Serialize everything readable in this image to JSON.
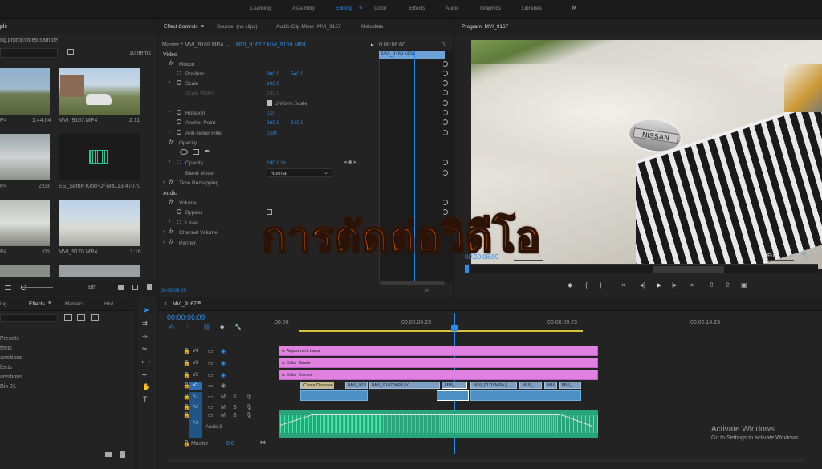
{
  "workspace": {
    "tabs": [
      "Learning",
      "Assembly",
      "Editing",
      "Color",
      "Effects",
      "Audio",
      "Graphics",
      "Libraries"
    ],
    "active": "Editing",
    "more": "»"
  },
  "project": {
    "title_partial": "ple",
    "path_partial": "ng.prproj\\Video sample",
    "items_count": "10 Items",
    "clips": [
      {
        "name": "P4",
        "duration": "1:44:04"
      },
      {
        "name": "MVI_9167.MP4",
        "duration": "2:11"
      },
      {
        "name": "P4",
        "duration": "2:03"
      },
      {
        "name": "ES_Some-Kind-Of-Ma...",
        "duration": "13:47070"
      },
      {
        "name": "P4",
        "duration": ":05"
      },
      {
        "name": "MVI_9170.MP4",
        "duration": "1:16"
      }
    ],
    "bin_label": "Bin"
  },
  "effects_panel": {
    "tabs": [
      "ing",
      "Effects",
      "Markers",
      "Hist"
    ],
    "items": [
      "Presets",
      "fects",
      "ansitions",
      "fects",
      "ansitions",
      "Bin 01"
    ]
  },
  "effect_controls": {
    "tabs": [
      "Effect Controls",
      "Source: (no clips)",
      "Audio Clip Mixer: MVI_9167",
      "Metadata"
    ],
    "master": "Master * MVI_9169.MP4",
    "clip": "MVI_9167 * MVI_9169.MP4",
    "timecode_top": "0:00:06:00",
    "timecode_end": "0",
    "clip_bar": "MVI_9169.MP4",
    "section_video": "Video",
    "section_audio": "Audio",
    "rows": [
      {
        "label": "Motion",
        "fx": true
      },
      {
        "label": "Position",
        "v1": "960.0",
        "v2": "540.0"
      },
      {
        "label": "Scale",
        "v1": "100.0"
      },
      {
        "label": "Scale Width",
        "v1": "100.0"
      },
      {
        "label": "Uniform Scale"
      },
      {
        "label": "Rotation",
        "v1": "0.0"
      },
      {
        "label": "Anchor Point",
        "v1": "960.0",
        "v2": "540.0"
      },
      {
        "label": "Anti-flicker Filter",
        "v1": "0.00"
      },
      {
        "label": "Opacity",
        "fx": true
      },
      {
        "label": "Opacity",
        "v1": "100.0 %"
      },
      {
        "label": "Blend Mode",
        "v1": "Normal"
      },
      {
        "label": "Time Remapping",
        "fx": true
      },
      {
        "label": "Volume",
        "fx": true
      },
      {
        "label": "Bypass"
      },
      {
        "label": "Level"
      },
      {
        "label": "Channel Volume",
        "fx": true
      },
      {
        "label": "Panner",
        "fx": true
      }
    ],
    "timecode_bottom": "00:00:06:09"
  },
  "program": {
    "title": "Program: MVI_9167",
    "timecode": "00:00:06:09",
    "fit": "Fit",
    "quality": "Full",
    "badge": "NISSAN"
  },
  "overlay_title": "การตัดต่อวิดีโอ",
  "timeline": {
    "sequence": "MVI_9167",
    "timecode": "00:00:06:09",
    "ruler": [
      ":00:00",
      "00:00:04:23",
      "00:00:09:23",
      "00:00:14:23"
    ],
    "tracks": [
      "V4",
      "V3",
      "V2",
      "V1",
      "A1",
      "A2",
      "A3"
    ],
    "audio_name": "Audio 3",
    "master_label": "Master",
    "master_value": "0.0",
    "adjustment_clips": [
      "Adjustment Layer",
      "Color Grade",
      "Color Correct"
    ],
    "video_clips": [
      "Cross Dissolve",
      "MVI_916",
      "MVI_9167.MP4 [V]",
      "MVI_",
      "MVI_9170.MP4 [",
      "MVI_",
      "MVI_",
      "MVI_"
    ],
    "track_buttons": {
      "m": "M",
      "s": "S"
    }
  },
  "watermark": {
    "title": "Activate Windows",
    "subtitle": "Go to Settings to activate Windows."
  },
  "colors": {
    "accent": "#2d8ceb",
    "adjustment": "#e080e0",
    "audio_wave": "#2cc590",
    "title_fill": "#ff6a00",
    "title_stroke": "#2a1206"
  }
}
